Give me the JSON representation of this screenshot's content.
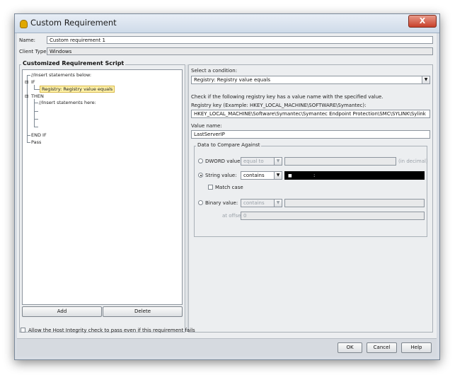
{
  "window": {
    "title": "Custom Requirement",
    "close_label": "X"
  },
  "fields": {
    "name_label": "Name:",
    "name_value": "Custom requirement 1",
    "client_type_label": "Client Type:",
    "client_type_value": "Windows"
  },
  "script_panel": {
    "title": "Customized Requirement Script",
    "tree": {
      "insert_below": "//Insert statements below:",
      "if": "IF",
      "condition": "Registry: Registry value equals",
      "then": "THEN",
      "insert_here": "//Insert statements here:",
      "end_if": "END IF",
      "pass": "Pass"
    },
    "add_label": "Add",
    "delete_label": "Delete"
  },
  "condition_panel": {
    "select_label": "Select a condition:",
    "select_value": "Registry: Registry value equals",
    "check_text": "Check if the following registry key has a value name with the specified value.",
    "regkey_label": "Registry key (Example: HKEY_LOCAL_MACHINE\\SOFTWARE\\Symantec):",
    "regkey_value": "HKEY_LOCAL_MACHINE\\Software\\Symantec\\Symantec Endpoint Protection\\SMC\\SYLINK\\Sylink",
    "value_name_label": "Value name:",
    "value_name_value": "LastServerIP",
    "compare_title": "Data to Compare Against",
    "dword_label": "DWORD value:",
    "dword_op": "equal to",
    "dword_suffix": "(in decimal)",
    "string_label": "String value:",
    "string_op": "contains",
    "match_case_label": "Match case",
    "binary_label": "Binary value:",
    "binary_op": "contains",
    "offset_label": "at offset:",
    "offset_value": "0"
  },
  "footer": {
    "allow_label": "Allow the Host Integrity check to pass even if this requirement fails",
    "ok_label": "OK",
    "cancel_label": "Cancel",
    "help_label": "Help"
  }
}
